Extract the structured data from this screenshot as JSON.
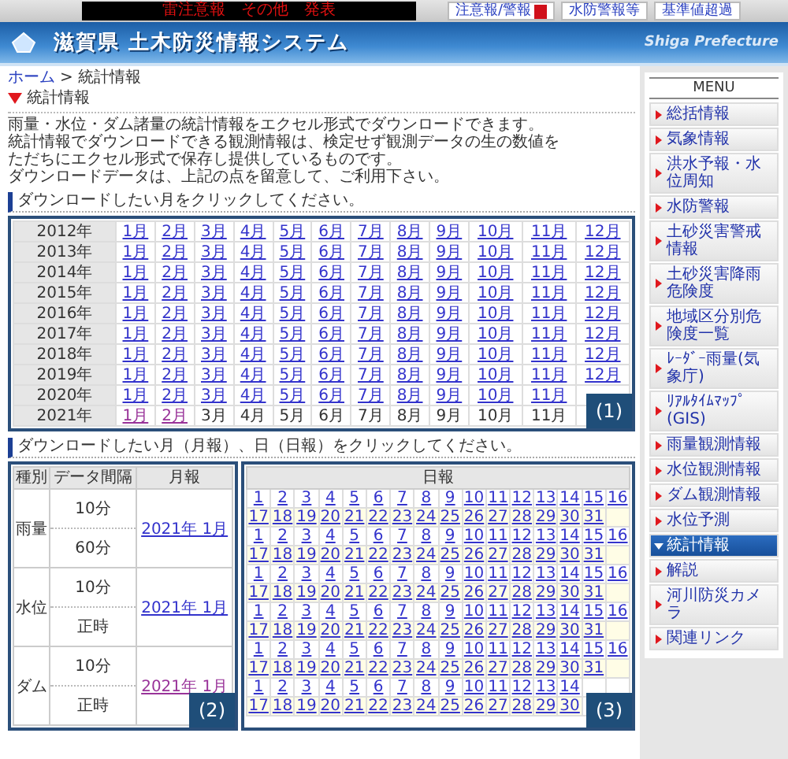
{
  "top_bar": {
    "ticker": "雷注意報　その他　発表",
    "buttons": [
      {
        "label": "注意報/警報",
        "kind": "alert"
      },
      {
        "label": "水防警報等",
        "kind": "plain"
      },
      {
        "label": "基準値超過",
        "kind": "plain"
      }
    ]
  },
  "header": {
    "title": "滋賀県 土木防災情報システム",
    "subtitle": "Shiga Prefecture"
  },
  "breadcrumb": {
    "home": "ホーム",
    "separator": ">",
    "current": "統計情報"
  },
  "page_title": "統計情報",
  "intro": [
    "雨量・水位・ダム諸量の統計情報をエクセル形式でダウンロードできます。",
    "統計情報でダウンロードできる観測情報は、検定せず観測データの生の数値を",
    "ただちにエクセル形式で保存し提供しているものです。",
    "ダウンロードデータは、上記の点を留意して、ご利用下さい。"
  ],
  "monthly_section": {
    "heading": "ダウンロードしたい月をクリックしてください。",
    "badge": "(1)",
    "rows": [
      {
        "year": "2012年",
        "months": [
          {
            "label": "1月",
            "kind": "link"
          },
          {
            "label": "2月",
            "kind": "link"
          },
          {
            "label": "3月",
            "kind": "link"
          },
          {
            "label": "4月",
            "kind": "link"
          },
          {
            "label": "5月",
            "kind": "link"
          },
          {
            "label": "6月",
            "kind": "link"
          },
          {
            "label": "7月",
            "kind": "link"
          },
          {
            "label": "8月",
            "kind": "link"
          },
          {
            "label": "9月",
            "kind": "link"
          },
          {
            "label": "10月",
            "kind": "link"
          },
          {
            "label": "11月",
            "kind": "link"
          },
          {
            "label": "12月",
            "kind": "link"
          }
        ]
      },
      {
        "year": "2013年",
        "months": [
          {
            "label": "1月",
            "kind": "link"
          },
          {
            "label": "2月",
            "kind": "link"
          },
          {
            "label": "3月",
            "kind": "link"
          },
          {
            "label": "4月",
            "kind": "link"
          },
          {
            "label": "5月",
            "kind": "link"
          },
          {
            "label": "6月",
            "kind": "link"
          },
          {
            "label": "7月",
            "kind": "link"
          },
          {
            "label": "8月",
            "kind": "link"
          },
          {
            "label": "9月",
            "kind": "link"
          },
          {
            "label": "10月",
            "kind": "link"
          },
          {
            "label": "11月",
            "kind": "link"
          },
          {
            "label": "12月",
            "kind": "link"
          }
        ]
      },
      {
        "year": "2014年",
        "months": [
          {
            "label": "1月",
            "kind": "link"
          },
          {
            "label": "2月",
            "kind": "link"
          },
          {
            "label": "3月",
            "kind": "link"
          },
          {
            "label": "4月",
            "kind": "link"
          },
          {
            "label": "5月",
            "kind": "link"
          },
          {
            "label": "6月",
            "kind": "link"
          },
          {
            "label": "7月",
            "kind": "link"
          },
          {
            "label": "8月",
            "kind": "link"
          },
          {
            "label": "9月",
            "kind": "link"
          },
          {
            "label": "10月",
            "kind": "link"
          },
          {
            "label": "11月",
            "kind": "link"
          },
          {
            "label": "12月",
            "kind": "link"
          }
        ]
      },
      {
        "year": "2015年",
        "months": [
          {
            "label": "1月",
            "kind": "link"
          },
          {
            "label": "2月",
            "kind": "link"
          },
          {
            "label": "3月",
            "kind": "link"
          },
          {
            "label": "4月",
            "kind": "link"
          },
          {
            "label": "5月",
            "kind": "link"
          },
          {
            "label": "6月",
            "kind": "link"
          },
          {
            "label": "7月",
            "kind": "link"
          },
          {
            "label": "8月",
            "kind": "link"
          },
          {
            "label": "9月",
            "kind": "link"
          },
          {
            "label": "10月",
            "kind": "link"
          },
          {
            "label": "11月",
            "kind": "link"
          },
          {
            "label": "12月",
            "kind": "link"
          }
        ]
      },
      {
        "year": "2016年",
        "months": [
          {
            "label": "1月",
            "kind": "link"
          },
          {
            "label": "2月",
            "kind": "link"
          },
          {
            "label": "3月",
            "kind": "link"
          },
          {
            "label": "4月",
            "kind": "link"
          },
          {
            "label": "5月",
            "kind": "link"
          },
          {
            "label": "6月",
            "kind": "link"
          },
          {
            "label": "7月",
            "kind": "link"
          },
          {
            "label": "8月",
            "kind": "link"
          },
          {
            "label": "9月",
            "kind": "link"
          },
          {
            "label": "10月",
            "kind": "link"
          },
          {
            "label": "11月",
            "kind": "link"
          },
          {
            "label": "12月",
            "kind": "link"
          }
        ]
      },
      {
        "year": "2017年",
        "months": [
          {
            "label": "1月",
            "kind": "link"
          },
          {
            "label": "2月",
            "kind": "link"
          },
          {
            "label": "3月",
            "kind": "link"
          },
          {
            "label": "4月",
            "kind": "link"
          },
          {
            "label": "5月",
            "kind": "link"
          },
          {
            "label": "6月",
            "kind": "link"
          },
          {
            "label": "7月",
            "kind": "link"
          },
          {
            "label": "8月",
            "kind": "link"
          },
          {
            "label": "9月",
            "kind": "link"
          },
          {
            "label": "10月",
            "kind": "link"
          },
          {
            "label": "11月",
            "kind": "link"
          },
          {
            "label": "12月",
            "kind": "link"
          }
        ]
      },
      {
        "year": "2018年",
        "months": [
          {
            "label": "1月",
            "kind": "link"
          },
          {
            "label": "2月",
            "kind": "link"
          },
          {
            "label": "3月",
            "kind": "link"
          },
          {
            "label": "4月",
            "kind": "link"
          },
          {
            "label": "5月",
            "kind": "link"
          },
          {
            "label": "6月",
            "kind": "link"
          },
          {
            "label": "7月",
            "kind": "link"
          },
          {
            "label": "8月",
            "kind": "link"
          },
          {
            "label": "9月",
            "kind": "link"
          },
          {
            "label": "10月",
            "kind": "link"
          },
          {
            "label": "11月",
            "kind": "link"
          },
          {
            "label": "12月",
            "kind": "link"
          }
        ]
      },
      {
        "year": "2019年",
        "months": [
          {
            "label": "1月",
            "kind": "link"
          },
          {
            "label": "2月",
            "kind": "link"
          },
          {
            "label": "3月",
            "kind": "link"
          },
          {
            "label": "4月",
            "kind": "link"
          },
          {
            "label": "5月",
            "kind": "link"
          },
          {
            "label": "6月",
            "kind": "link"
          },
          {
            "label": "7月",
            "kind": "link"
          },
          {
            "label": "8月",
            "kind": "link"
          },
          {
            "label": "9月",
            "kind": "link"
          },
          {
            "label": "10月",
            "kind": "link"
          },
          {
            "label": "11月",
            "kind": "link"
          },
          {
            "label": "12月",
            "kind": "link"
          }
        ]
      },
      {
        "year": "2020年",
        "months": [
          {
            "label": "1月",
            "kind": "link"
          },
          {
            "label": "2月",
            "kind": "link"
          },
          {
            "label": "3月",
            "kind": "link"
          },
          {
            "label": "4月",
            "kind": "link"
          },
          {
            "label": "5月",
            "kind": "link"
          },
          {
            "label": "6月",
            "kind": "link"
          },
          {
            "label": "7月",
            "kind": "link"
          },
          {
            "label": "8月",
            "kind": "link"
          },
          {
            "label": "9月",
            "kind": "link"
          },
          {
            "label": "10月",
            "kind": "link"
          },
          {
            "label": "11月",
            "kind": "link"
          }
        ]
      },
      {
        "year": "2021年",
        "months": [
          {
            "label": "1月",
            "kind": "visited"
          },
          {
            "label": "2月",
            "kind": "visited"
          },
          {
            "label": "3月",
            "kind": "none"
          },
          {
            "label": "4月",
            "kind": "none"
          },
          {
            "label": "5月",
            "kind": "none"
          },
          {
            "label": "6月",
            "kind": "none"
          },
          {
            "label": "7月",
            "kind": "none"
          },
          {
            "label": "8月",
            "kind": "none"
          },
          {
            "label": "9月",
            "kind": "none"
          },
          {
            "label": "10月",
            "kind": "none"
          },
          {
            "label": "11月",
            "kind": "none"
          }
        ]
      }
    ]
  },
  "daily_section": {
    "heading": "ダウンロードしたい月（月報）、日（日報）をクリックしてください。",
    "columns": [
      "種別",
      "データ間隔",
      "月報"
    ],
    "daily_header": "日報",
    "badge_left": "(2)",
    "badge_right": "(3)",
    "groups": [
      {
        "type": "雨量",
        "monthly_link": {
          "label": "2021年 1月",
          "visited": false
        },
        "intervals": [
          {
            "label": "10分",
            "first_line": [
              "1",
              "2",
              "3",
              "4",
              "5",
              "6",
              "7",
              "8",
              "9",
              "10",
              "11",
              "12",
              "13",
              "14",
              "15",
              "16"
            ],
            "second_line": [
              "17",
              "18",
              "19",
              "20",
              "21",
              "22",
              "23",
              "24",
              "25",
              "26",
              "27",
              "28",
              "29",
              "30",
              "31"
            ]
          },
          {
            "label": "60分",
            "first_line": [
              "1",
              "2",
              "3",
              "4",
              "5",
              "6",
              "7",
              "8",
              "9",
              "10",
              "11",
              "12",
              "13",
              "14",
              "15",
              "16"
            ],
            "second_line": [
              "17",
              "18",
              "19",
              "20",
              "21",
              "22",
              "23",
              "24",
              "25",
              "26",
              "27",
              "28",
              "29",
              "30",
              "31"
            ]
          }
        ]
      },
      {
        "type": "水位",
        "monthly_link": {
          "label": "2021年 1月",
          "visited": false
        },
        "intervals": [
          {
            "label": "10分",
            "first_line": [
              "1",
              "2",
              "3",
              "4",
              "5",
              "6",
              "7",
              "8",
              "9",
              "10",
              "11",
              "12",
              "13",
              "14",
              "15",
              "16"
            ],
            "second_line": [
              "17",
              "18",
              "19",
              "20",
              "21",
              "22",
              "23",
              "24",
              "25",
              "26",
              "27",
              "28",
              "29",
              "30",
              "31"
            ]
          },
          {
            "label": "正時",
            "first_line": [
              "1",
              "2",
              "3",
              "4",
              "5",
              "6",
              "7",
              "8",
              "9",
              "10",
              "11",
              "12",
              "13",
              "14",
              "15",
              "16"
            ],
            "second_line": [
              "17",
              "18",
              "19",
              "20",
              "21",
              "22",
              "23",
              "24",
              "25",
              "26",
              "27",
              "28",
              "29",
              "30",
              "31"
            ]
          }
        ]
      },
      {
        "type": "ダム",
        "monthly_link": {
          "label": "2021年 1月",
          "visited": true
        },
        "intervals": [
          {
            "label": "10分",
            "first_line": [
              "1",
              "2",
              "3",
              "4",
              "5",
              "6",
              "7",
              "8",
              "9",
              "10",
              "11",
              "12",
              "13",
              "14",
              "15",
              "16"
            ],
            "second_line": [
              "17",
              "18",
              "19",
              "20",
              "21",
              "22",
              "23",
              "24",
              "25",
              "26",
              "27",
              "28",
              "29",
              "30",
              "31"
            ]
          },
          {
            "label": "正時",
            "first_line": [
              "1",
              "2",
              "3",
              "4",
              "5",
              "6",
              "7",
              "8",
              "9",
              "10",
              "11",
              "12",
              "13",
              "14"
            ],
            "second_line": [
              "17",
              "18",
              "19",
              "20",
              "21",
              "22",
              "23",
              "24",
              "25",
              "26",
              "27",
              "28",
              "29",
              "30"
            ]
          }
        ]
      }
    ]
  },
  "menu": {
    "title": "MENU",
    "items": [
      {
        "label": "総括情報",
        "selected": false
      },
      {
        "label": "気象情報",
        "selected": false
      },
      {
        "label": "洪水予報・水位周知",
        "selected": false
      },
      {
        "label": "水防警報",
        "selected": false
      },
      {
        "label": "土砂災害警戒情報",
        "selected": false
      },
      {
        "label": "土砂災害降雨危険度",
        "selected": false
      },
      {
        "label": "地域区分別危険度一覧",
        "selected": false
      },
      {
        "label": "ﾚｰﾀﾞｰ雨量(気象庁)",
        "selected": false
      },
      {
        "label": "ﾘｱﾙﾀｲﾑﾏｯﾌﾟ(GIS)",
        "selected": false
      },
      {
        "label": "雨量観測情報",
        "selected": false
      },
      {
        "label": "水位観測情報",
        "selected": false
      },
      {
        "label": "ダム観測情報",
        "selected": false
      },
      {
        "label": "水位予測",
        "selected": false
      },
      {
        "label": "統計情報",
        "selected": true
      },
      {
        "label": "解説",
        "selected": false
      },
      {
        "label": "河川防災カメラ",
        "selected": false
      },
      {
        "label": "関連リンク",
        "selected": false
      }
    ]
  }
}
